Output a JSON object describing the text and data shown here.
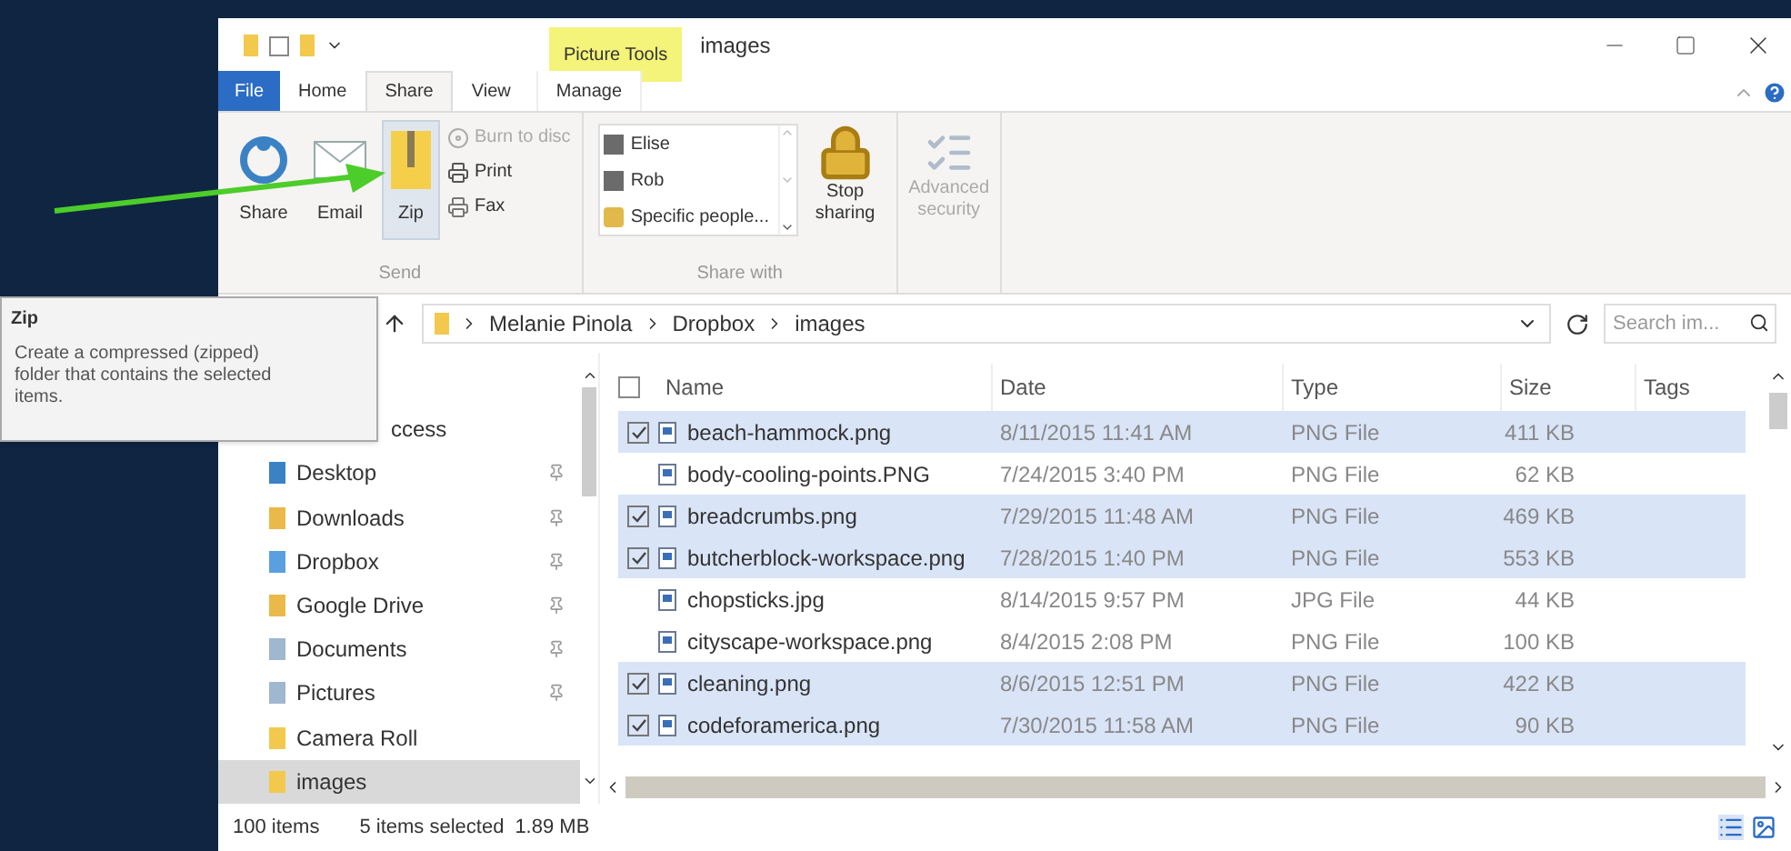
{
  "window": {
    "context_tab": "Picture Tools",
    "title": "images"
  },
  "ribbon_tabs": [
    {
      "label": "File",
      "kind": "file",
      "selected": false
    },
    {
      "label": "Home",
      "kind": "tab",
      "selected": false
    },
    {
      "label": "Share",
      "kind": "tab",
      "selected": true
    },
    {
      "label": "View",
      "kind": "tab",
      "selected": false
    },
    {
      "label": "Manage",
      "kind": "context",
      "selected": false
    }
  ],
  "send_group": {
    "label": "Send",
    "buttons": [
      {
        "label": "Share",
        "kind": "share",
        "selected": false
      },
      {
        "label": "Email",
        "kind": "email",
        "selected": false
      },
      {
        "label": "Zip",
        "kind": "zip",
        "selected": true
      }
    ],
    "small_buttons": [
      {
        "label": "Burn to disc",
        "kind": "disc",
        "disabled": true
      },
      {
        "label": "Print",
        "kind": "print",
        "disabled": false
      },
      {
        "label": "Fax",
        "kind": "fax",
        "disabled": false
      }
    ]
  },
  "share_group": {
    "label": "Share with",
    "people": [
      {
        "label": "Elise",
        "kind": "person"
      },
      {
        "label": "Rob",
        "kind": "person"
      },
      {
        "label": "Specific people...",
        "kind": "group"
      }
    ],
    "stop_sharing": {
      "label": "Stop sharing",
      "disabled": false
    },
    "advanced_security": {
      "label": "Advanced security",
      "disabled": true
    }
  },
  "address": {
    "path": [
      "Melanie Pinola",
      "Dropbox",
      "images"
    ],
    "search_placeholder": "Search im..."
  },
  "nav": [
    {
      "label": "ccess",
      "pinned": false,
      "selected": false
    },
    {
      "label": "Desktop",
      "kind": "desktop",
      "pinned": true,
      "selected": false
    },
    {
      "label": "Downloads",
      "kind": "downloads",
      "pinned": true,
      "selected": false
    },
    {
      "label": "Dropbox",
      "kind": "dropbox",
      "pinned": true,
      "selected": false
    },
    {
      "label": "Google Drive",
      "kind": "drive",
      "pinned": true,
      "selected": false
    },
    {
      "label": "Documents",
      "kind": "documents",
      "pinned": true,
      "selected": false
    },
    {
      "label": "Pictures",
      "kind": "pictures",
      "pinned": true,
      "selected": false
    },
    {
      "label": "Camera Roll",
      "kind": "folder",
      "pinned": false,
      "selected": false
    },
    {
      "label": "images",
      "kind": "folder",
      "pinned": false,
      "selected": true
    }
  ],
  "select_all": {
    "checked": false
  },
  "columns": [
    "Name",
    "Date",
    "Type",
    "Size",
    "Tags"
  ],
  "rows": [
    {
      "name": "beach-hammock.png",
      "date": "8/11/2015 11:41 AM",
      "type": "PNG File",
      "size": "411 KB",
      "selected": true
    },
    {
      "name": "body-cooling-points.PNG",
      "date": "7/24/2015 3:40 PM",
      "type": "PNG File",
      "size": "62 KB",
      "selected": false
    },
    {
      "name": "breadcrumbs.png",
      "date": "7/29/2015 11:48 AM",
      "type": "PNG File",
      "size": "469 KB",
      "selected": true
    },
    {
      "name": "butcherblock-workspace.png",
      "date": "7/28/2015 1:40 PM",
      "type": "PNG File",
      "size": "553 KB",
      "selected": true
    },
    {
      "name": "chopsticks.jpg",
      "date": "8/14/2015 9:57 PM",
      "type": "JPG File",
      "size": "44 KB",
      "selected": false
    },
    {
      "name": "cityscape-workspace.png",
      "date": "8/4/2015 2:08 PM",
      "type": "PNG File",
      "size": "100 KB",
      "selected": false
    },
    {
      "name": "cleaning.png",
      "date": "8/6/2015 12:51 PM",
      "type": "PNG File",
      "size": "422 KB",
      "selected": true
    },
    {
      "name": "codeforamerica.png",
      "date": "7/30/2015 11:58 AM",
      "type": "PNG File",
      "size": "90 KB",
      "selected": true
    }
  ],
  "status_bar": {
    "count": "100 items",
    "selection": "5 items selected",
    "size": "1.89 MB"
  },
  "tooltip": {
    "title": "Zip",
    "text": "Create a compressed (zipped) folder that contains the selected items."
  }
}
